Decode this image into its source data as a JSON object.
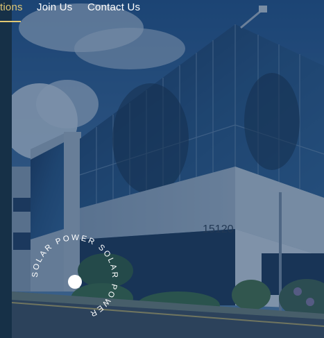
{
  "nav": {
    "items": [
      {
        "label": "tions",
        "active": true
      },
      {
        "label": "Join Us",
        "active": false
      },
      {
        "label": "Contact Us",
        "active": false
      }
    ]
  },
  "hero": {
    "building_number": "15120"
  },
  "badge": {
    "circular_text": "SOLAR POWER SOLAR POWER "
  },
  "colors": {
    "accent": "#e2c872",
    "sidebar": "#163047",
    "overlay": "#1b3a62"
  }
}
